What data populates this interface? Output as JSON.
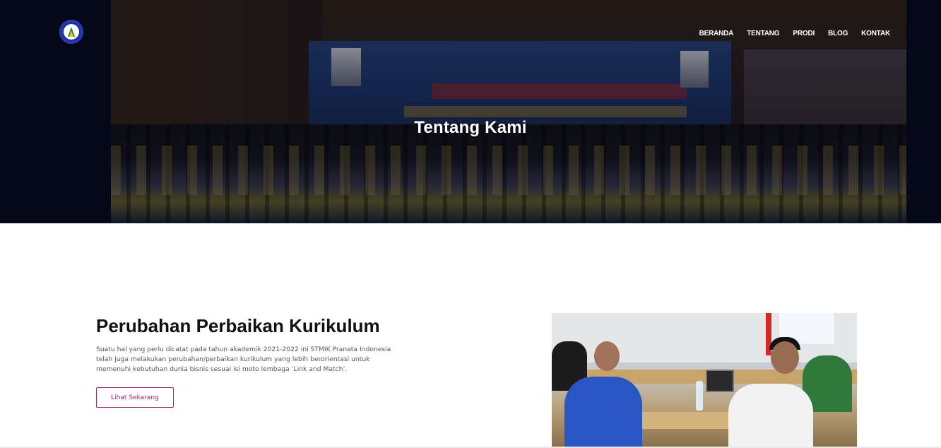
{
  "header": {
    "logo_icon": "institution-seal-logo",
    "nav": [
      {
        "label": "BERANDA"
      },
      {
        "label": "TENTANG"
      },
      {
        "label": "PRODI"
      },
      {
        "label": "BLOG"
      },
      {
        "label": "KONTAK"
      }
    ]
  },
  "hero": {
    "title": "Tentang Kami",
    "photo_description_icon": "graduation-ceremony-photo"
  },
  "section": {
    "heading": "Perubahan Perbaikan Kurikulum",
    "description": "Suatu hal yang perlu dicatat pada tahun akademik 2021-2022 ini STMIK Pranata Indonesia telah juga melakukan perubahan/perbaikan kurikulum yang lebih berorientasi untuk memenuhi kebutuhan dunia bisnis sesuai isi moto lembaga ‘Link and Match’.",
    "cta_label": "Lihat Sekarang",
    "image_icon": "meeting-room-photo"
  },
  "colors": {
    "accent": "#a8216f",
    "hero_background": "#050818",
    "logo_blue": "#2230a8"
  }
}
